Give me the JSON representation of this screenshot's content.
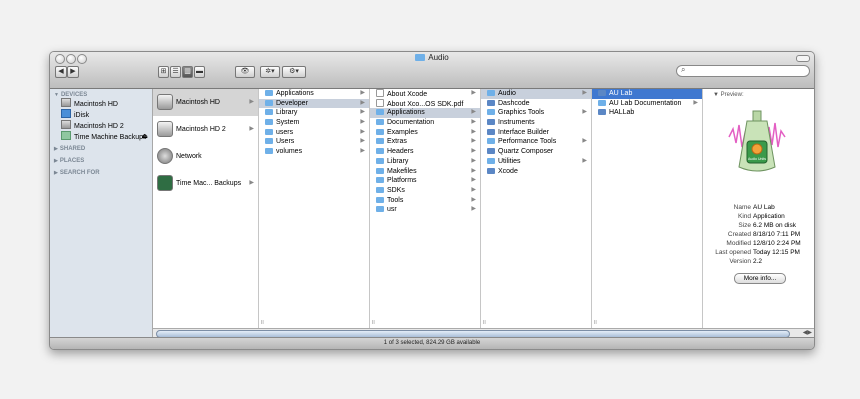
{
  "window": {
    "title": "Audio"
  },
  "toolbar": {
    "back": "◀",
    "forward": "▶",
    "view_buttons": [
      "⊞",
      "☰",
      "▥",
      "▬"
    ],
    "eye": "👁",
    "action": "✲▾",
    "arrange": "⚙▾",
    "search_placeholder": ""
  },
  "sidebar": {
    "devices_label": "DEVICES",
    "devices": [
      "Macintosh HD",
      "iDisk",
      "Macintosh HD 2",
      "Time Machine Backups"
    ],
    "shared_label": "SHARED",
    "places_label": "PLACES",
    "search_label": "SEARCH FOR"
  },
  "col1": [
    {
      "label": "Macintosh HD",
      "icon": "hd"
    },
    {
      "label": "Macintosh HD 2",
      "icon": "hd"
    },
    {
      "label": "Network",
      "icon": "net"
    },
    {
      "label": "Time Mac... Backups",
      "icon": "tm"
    }
  ],
  "col2": [
    "Applications",
    "Developer",
    "Library",
    "System",
    "users",
    "Users",
    "volumes"
  ],
  "col3": [
    "About Xcode",
    "About Xco...OS SDK.pdf",
    "Applications",
    "Documentation",
    "Examples",
    "Extras",
    "Headers",
    "Library",
    "Makefiles",
    "Platforms",
    "SDKs",
    "Tools",
    "usr"
  ],
  "col4": [
    "Audio",
    "Dashcode",
    "Graphics Tools",
    "Instruments",
    "Interface Builder",
    "Performance Tools",
    "Quartz Composer",
    "Utilities",
    "Xcode"
  ],
  "col5": [
    "AU Lab",
    "AU Lab Documentation",
    "HALLab"
  ],
  "preview": {
    "label": "Preview:",
    "icon_caption": "Audio Units",
    "info": [
      {
        "k": "Name",
        "v": "AU Lab"
      },
      {
        "k": "Kind",
        "v": "Application"
      },
      {
        "k": "Size",
        "v": "6.2 MB on disk"
      },
      {
        "k": "Created",
        "v": "8/18/10 7:11 PM"
      },
      {
        "k": "Modified",
        "v": "12/8/10 2:24 PM"
      },
      {
        "k": "Last opened",
        "v": "Today 12:15 PM"
      },
      {
        "k": "Version",
        "v": "2.2"
      }
    ],
    "more_info": "More info..."
  },
  "status": "1 of 3 selected, 824.29 GB available"
}
